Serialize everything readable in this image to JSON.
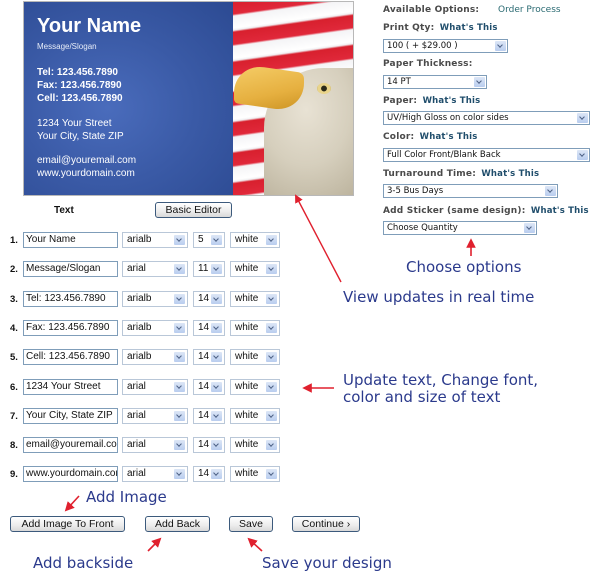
{
  "card_preview": {
    "name": "Your Name",
    "slogan": "Message/Slogan",
    "tel": "Tel: 123.456.7890",
    "fax": "Fax: 123.456.7890",
    "cell": "Cell: 123.456.7890",
    "street": "1234 Your Street",
    "city": "Your City, State ZIP",
    "email": "email@youremail.com",
    "web": "www.yourdomain.com",
    "background_color": "#3a5aa8"
  },
  "options": {
    "title": "Available Options:",
    "order_process_link": "Order Process",
    "whats_this": "What's This",
    "print_qty": {
      "label": "Print Qty:",
      "value": "100 (  + $29.00 )"
    },
    "paper_thickness": {
      "label": "Paper Thickness:",
      "value": "14 PT"
    },
    "paper": {
      "label": "Paper:",
      "value": "UV/High Gloss on color sides"
    },
    "color": {
      "label": "Color:",
      "value": "Full Color Front/Blank Back"
    },
    "turnaround": {
      "label": "Turnaround Time:",
      "value": "3-5 Bus Days"
    },
    "sticker": {
      "label": "Add Sticker (same design):",
      "value": "Choose Quantity"
    }
  },
  "editor": {
    "text_header": "Text",
    "basic_editor_button": "Basic Editor",
    "rows": [
      {
        "num": "1.",
        "text": "Your Name",
        "font": "arialb",
        "size": "5",
        "color": "white"
      },
      {
        "num": "2.",
        "text": "Message/Slogan",
        "font": "arial",
        "size": "11",
        "color": "white"
      },
      {
        "num": "3.",
        "text": "Tel: 123.456.7890",
        "font": "arialb",
        "size": "14",
        "color": "white"
      },
      {
        "num": "4.",
        "text": "Fax: 123.456.7890",
        "font": "arialb",
        "size": "14",
        "color": "white"
      },
      {
        "num": "5.",
        "text": "Cell: 123.456.7890",
        "font": "arialb",
        "size": "14",
        "color": "white"
      },
      {
        "num": "6.",
        "text": "1234 Your Street",
        "font": "arial",
        "size": "14",
        "color": "white"
      },
      {
        "num": "7.",
        "text": "Your City, State ZIP",
        "font": "arial",
        "size": "14",
        "color": "white"
      },
      {
        "num": "8.",
        "text": "email@youremail.com",
        "font": "arial",
        "size": "14",
        "color": "white"
      },
      {
        "num": "9.",
        "text": "www.yourdomain.com",
        "font": "arial",
        "size": "14",
        "color": "white"
      }
    ]
  },
  "buttons": {
    "add_image_front": "Add Image To Front",
    "add_back": "Add Back",
    "save": "Save",
    "continue": "Continue ›"
  },
  "annotations": {
    "choose_options": "Choose options",
    "view_updates": "View updates in real time",
    "update_text_1": "Update text, Change font,",
    "update_text_2": "color and size of text",
    "add_image": "Add Image",
    "add_backside": "Add backside",
    "save_design": "Save your design",
    "annotation_color": "#2b3a8c",
    "arrow_color": "#e0202e"
  }
}
